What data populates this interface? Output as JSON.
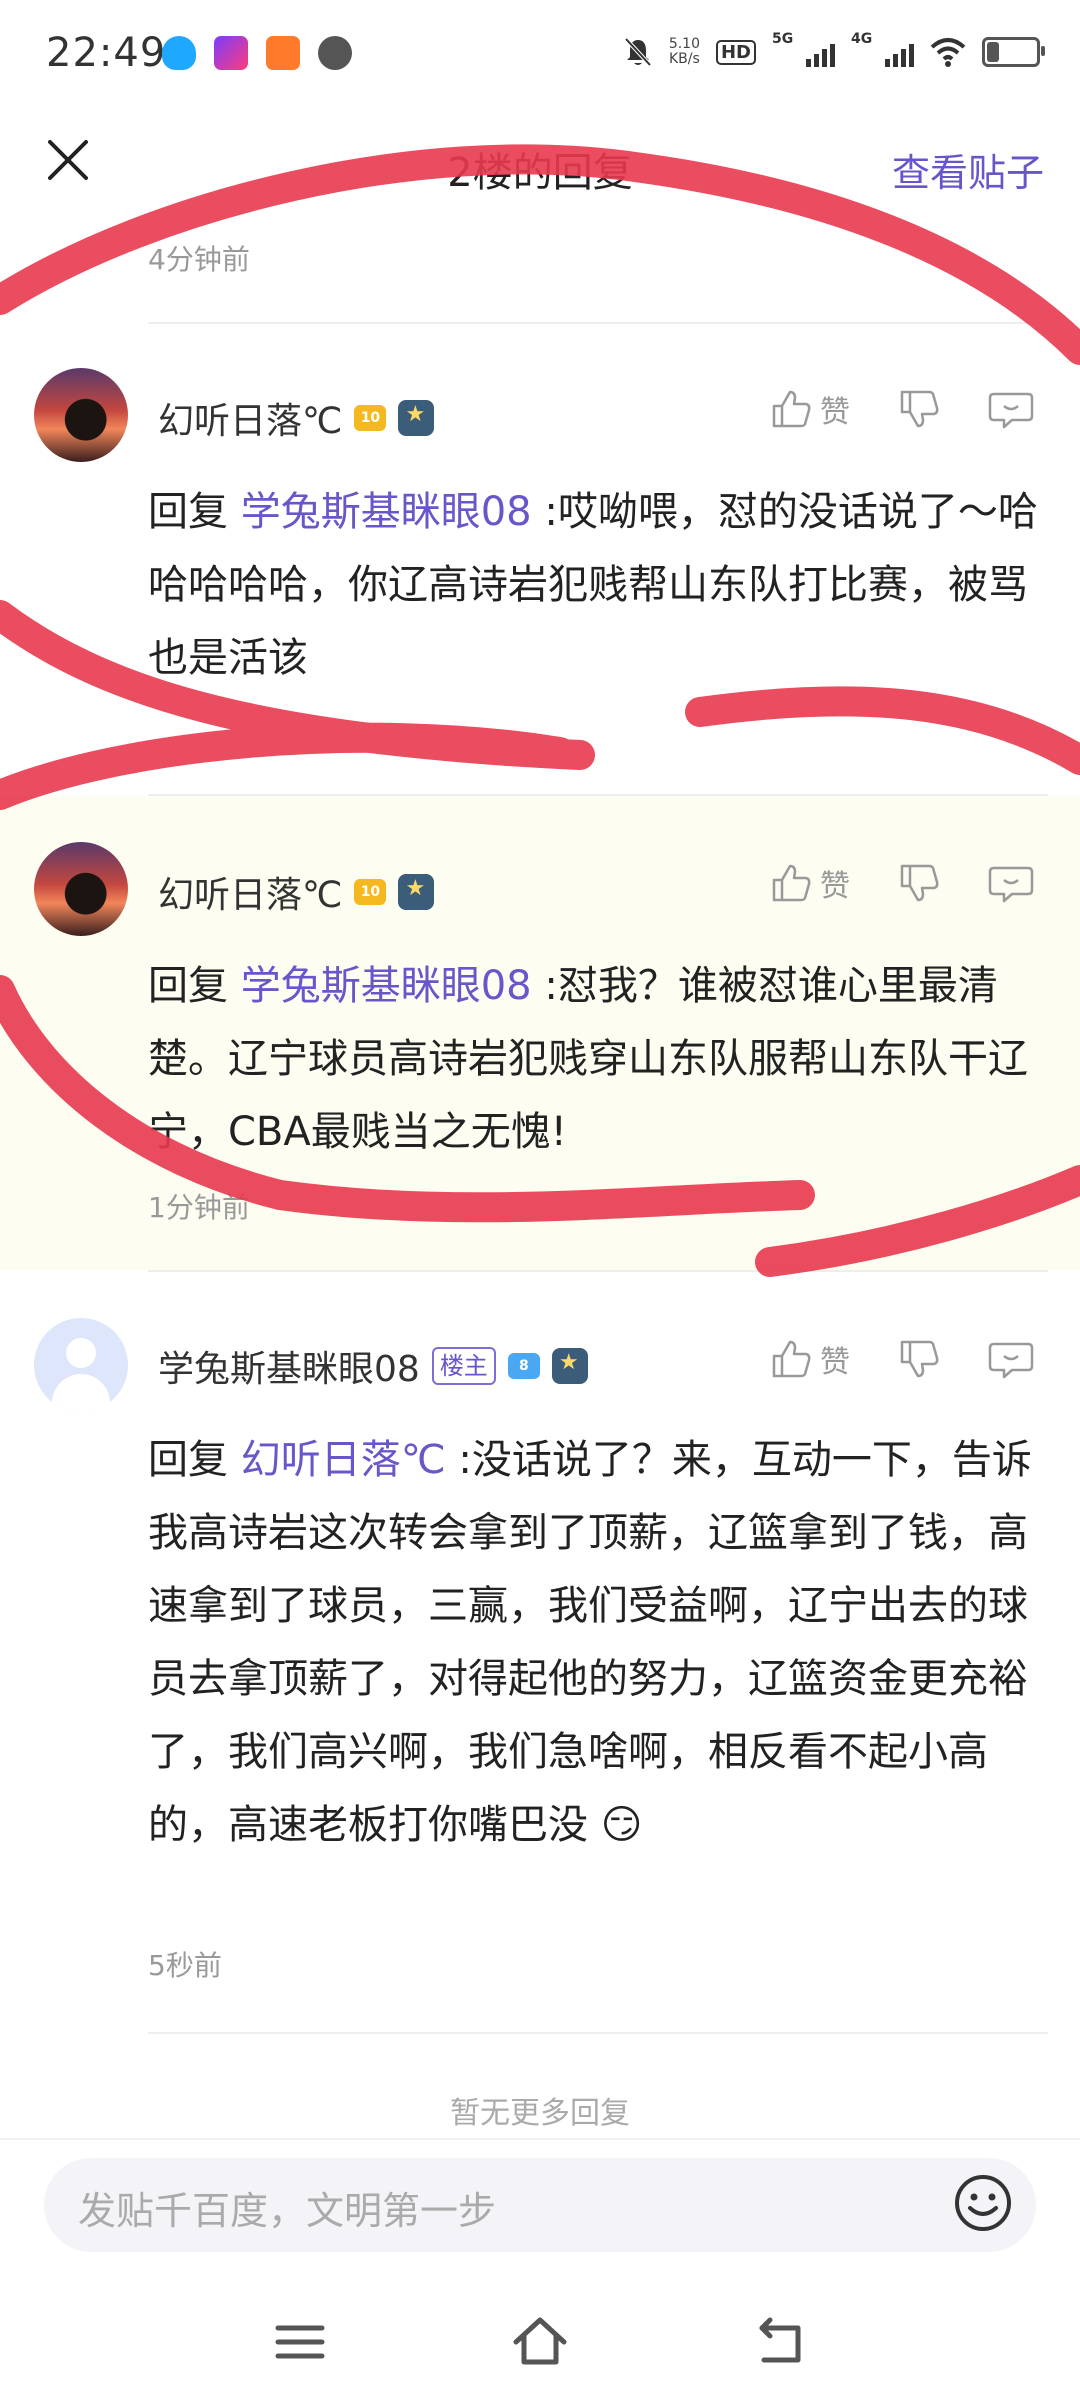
{
  "status_bar": {
    "time": "22:49",
    "net_speed_value": "5.10",
    "net_speed_unit": "KB/s",
    "hd_label": "HD",
    "signal1_label": "5G",
    "signal2_label": "4G",
    "battery_level": 0.25
  },
  "header": {
    "title": "2楼的回复",
    "view_post_label": "查看贴子"
  },
  "first_time": "4分钟前",
  "replies": [
    {
      "username": "幻听日落℃",
      "level": "10",
      "like_label": "赞",
      "reply_prefix": "回复",
      "mention": "学兔斯基眯眼08",
      "text": ":哎呦喂，怼的没话说了～哈哈哈哈哈，你辽高诗岩犯贱帮山东队打比赛，被骂也是活该"
    },
    {
      "username": "幻听日落℃",
      "level": "10",
      "like_label": "赞",
      "reply_prefix": "回复",
      "mention": "学兔斯基眯眼08",
      "text": ":怼我？谁被怼谁心里最清楚。辽宁球员高诗岩犯贱穿山东队服帮山东队干辽宁，CBA最贱当之无愧!",
      "time": "1分钟前"
    },
    {
      "username": "学兔斯基眯眼08",
      "owner_badge": "楼主",
      "level": "8",
      "like_label": "赞",
      "reply_prefix": "回复",
      "mention": "幻听日落℃",
      "text": ":没话说了？来，互动一下，告诉我高诗岩这次转会拿到了顶薪，辽篮拿到了钱，高速拿到了球员，三赢，我们受益啊，辽宁出去的球员去拿顶薪了，对得起他的努力，辽篮资金更充裕了，我们高兴啊，我们急啥啊，相反看不起小高的，高速老板打你嘴巴没",
      "emoji": "😏",
      "time": "5秒前"
    }
  ],
  "no_more": "暂无更多回复",
  "input": {
    "placeholder": "发贴千百度，文明第一步"
  },
  "colors": {
    "accent": "#6656c9",
    "scribble": "#e8394f",
    "highlight_bg": "#fdfdf2"
  }
}
